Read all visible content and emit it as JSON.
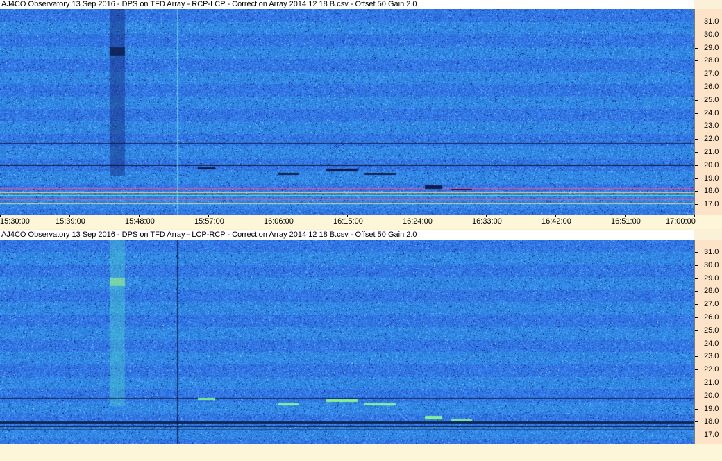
{
  "panels": [
    {
      "title": "AJ4CO Observatory 13 Sep 2016  -  DPS on TFD Array  -  RCP-LCP  -  Correction Array 2014 12 18 B.csv  -  Offset 50  Gain 2.0",
      "polarity": "RCP-LCP",
      "base_color": "#2f6fd8"
    },
    {
      "title": "AJ4CO Observatory 13 Sep 2016  -  DPS on TFD Array  -  LCP-RCP  -  Correction Array 2014 12 18 B.csv  -  Offset 50  Gain 2.0",
      "polarity": "LCP-RCP",
      "base_color": "#2f6fd8"
    }
  ],
  "freq_labels": [
    "31.0",
    "30.0",
    "29.0",
    "28.0",
    "27.0",
    "26.0",
    "25.0",
    "24.0",
    "23.0",
    "22.0",
    "21.0",
    "20.0",
    "19.0",
    "18.0",
    "17.0"
  ],
  "time_labels": [
    "15:30:00",
    "15:39:00",
    "15:48:00",
    "15:57:00",
    "16:06:00",
    "16:15:00",
    "16:24:00",
    "16:33:00",
    "16:42:00",
    "16:51:00",
    "17:00:00"
  ]
}
